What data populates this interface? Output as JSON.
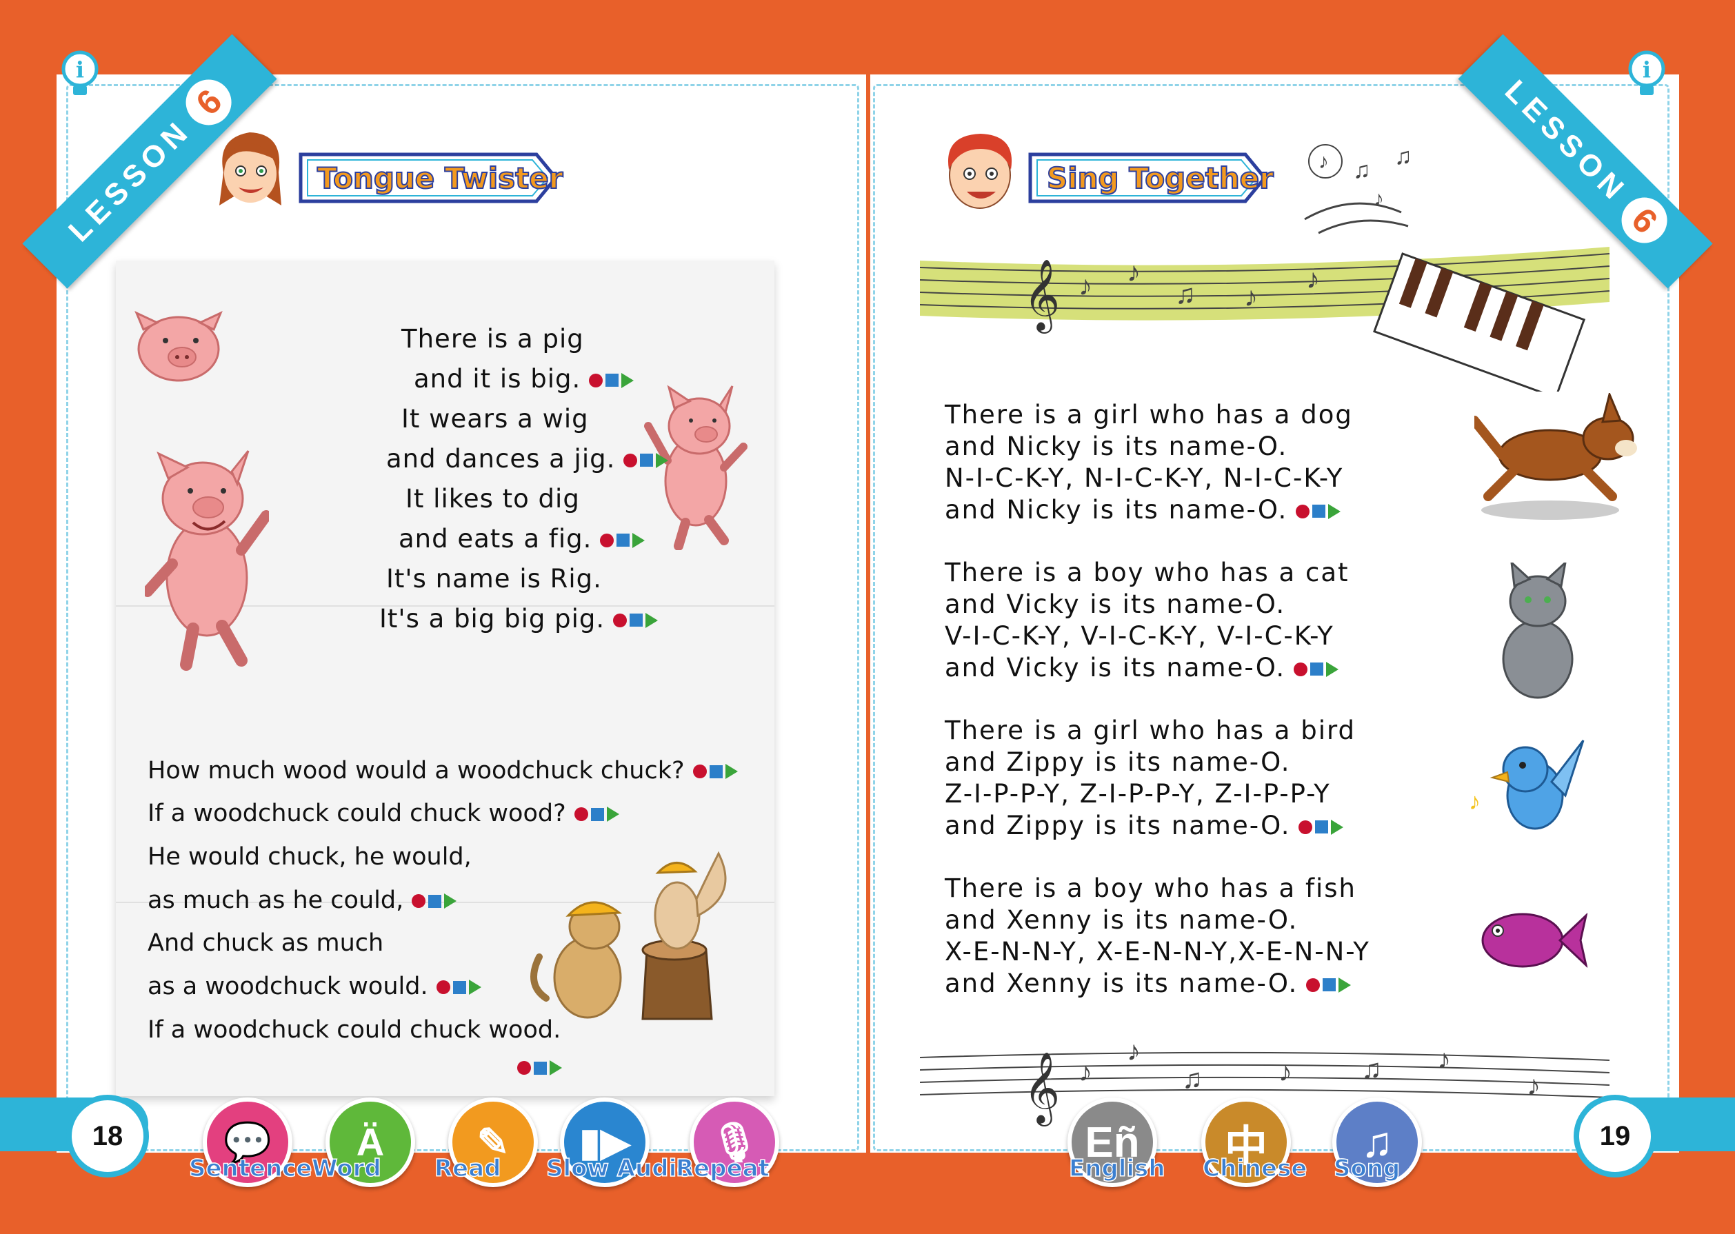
{
  "lesson": {
    "label": "LESSON",
    "number": "6"
  },
  "left_page": {
    "section_title": "Tongue Twister",
    "page_number": "18",
    "poem": [
      {
        "text": "There is a pig",
        "audio": false
      },
      {
        "text": "and it is big.",
        "audio": true
      },
      {
        "text": "It wears a wig",
        "audio": false
      },
      {
        "text": "and dances a jig.",
        "audio": true
      },
      {
        "text": "It likes to dig",
        "audio": false
      },
      {
        "text": "and eats a fig.",
        "audio": true
      },
      {
        "text": "It's name is Rig.",
        "audio": false
      },
      {
        "text": "It's a big big pig.",
        "audio": true
      }
    ],
    "woodchuck": [
      {
        "text": "How much wood would a woodchuck chuck?",
        "audio": true
      },
      {
        "text": "If a woodchuck could chuck wood?",
        "audio": true
      },
      {
        "text": "He would chuck, he would,",
        "audio": false
      },
      {
        "text": "as much as he could,",
        "audio": true
      },
      {
        "text": "And chuck as much",
        "audio": false
      },
      {
        "text": "as a woodchuck would.",
        "audio": true
      },
      {
        "text": "If a woodchuck could chuck wood.",
        "audio": false
      }
    ],
    "tools": [
      {
        "label": "Sentence",
        "icon": "speech-bubble-icon",
        "color": "#e3407f"
      },
      {
        "label": "Word",
        "icon": "letter-a-icon",
        "color": "#5fb83a"
      },
      {
        "label": "Read",
        "icon": "book-pencil-icon",
        "color": "#f29a1f"
      },
      {
        "label": "Slow Audio",
        "icon": "slow-play-icon",
        "color": "#2a86d0"
      },
      {
        "label": "Repeat",
        "icon": "microphone-icon",
        "color": "#d65bb5"
      }
    ]
  },
  "right_page": {
    "section_title": "Sing Together",
    "page_number": "19",
    "verses": [
      {
        "lines": [
          "There is a girl who has a dog",
          "and Nicky is its name-O.",
          "N-I-C-K-Y, N-I-C-K-Y, N-I-C-K-Y",
          "and Nicky is its name-O."
        ]
      },
      {
        "lines": [
          "There is a boy who has a cat",
          "and Vicky is its name-O.",
          "V-I-C-K-Y, V-I-C-K-Y, V-I-C-K-Y",
          "and Vicky is its name-O."
        ]
      },
      {
        "lines": [
          "There is a girl who has a bird",
          "and Zippy is its name-O.",
          "Z-I-P-P-Y, Z-I-P-P-Y, Z-I-P-P-Y",
          "and Zippy is its name-O."
        ]
      },
      {
        "lines": [
          "There is a boy who has a fish",
          "and Xenny is its name-O.",
          "X-E-N-N-Y, X-E-N-N-Y,X-E-N-N-Y",
          "and Xenny is its name-O."
        ]
      }
    ],
    "tools": [
      {
        "label": "English",
        "icon": "english-icon",
        "glyph": "Eñ",
        "color": "#8a8a8a"
      },
      {
        "label": "Chinese",
        "icon": "chinese-icon",
        "glyph": "中",
        "color": "#c98a2a"
      },
      {
        "label": "Song",
        "icon": "music-note-icon",
        "glyph": "♫",
        "color": "#5d7fc7"
      }
    ]
  },
  "colors": {
    "background": "#e8602a",
    "accent": "#2db4d8",
    "title_fill": "#f39a1f",
    "title_outline": "#2c3f9e"
  }
}
